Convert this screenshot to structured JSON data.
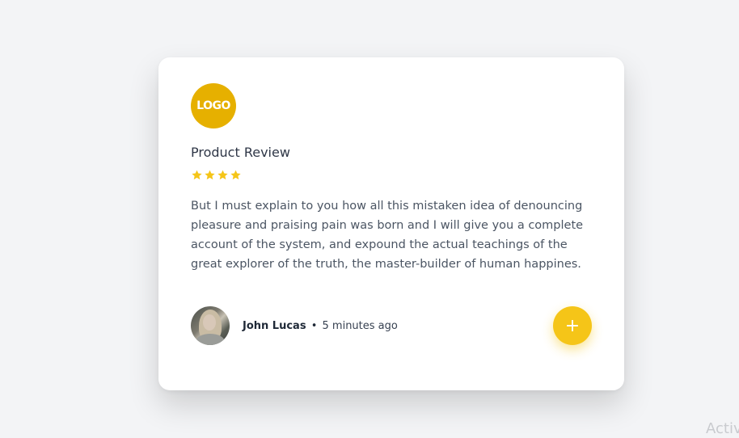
{
  "card": {
    "logo_text": "LOGO",
    "title": "Product Review",
    "rating": 4,
    "rating_max": 4,
    "body": "But I must explain to you how all this mistaken idea of denouncing pleasure and praising pain was born and I will give you a complete account of the system, and expound the actual teachings of the great explorer of the truth, the master-builder of human happines.",
    "author": {
      "name": "John Lucas",
      "separator": "•",
      "time": "5 minutes ago"
    },
    "fab_label": "+"
  },
  "watermark": "Activ",
  "colors": {
    "background": "#f3f4f6",
    "card": "#ffffff",
    "logo": "#e6b000",
    "star": "#f5c518",
    "fab": "#f5c518",
    "title": "#2f3747",
    "body": "#4b5563"
  },
  "icons": {
    "star": "star-icon",
    "fab": "plus-icon"
  }
}
